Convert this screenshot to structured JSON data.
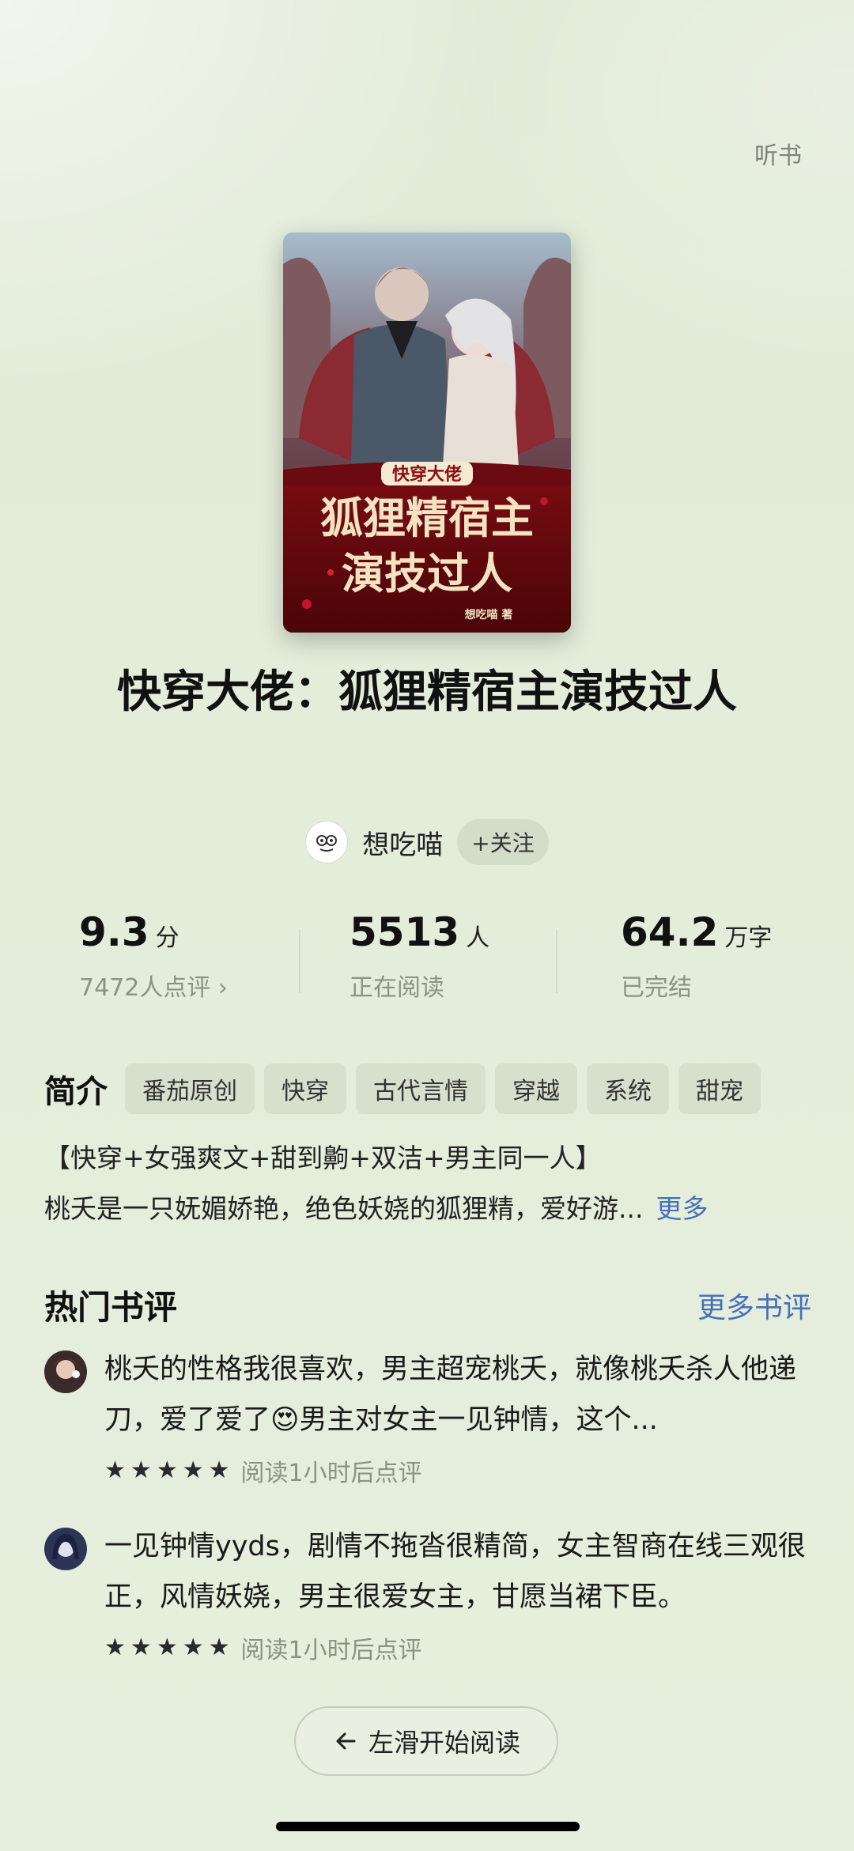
{
  "header": {
    "listen_label": "听书"
  },
  "book": {
    "cover_alt": "快穿大佬：狐狸精宿主演技过人",
    "title": "快穿大佬：狐狸精宿主演技过人",
    "author": "想吃喵",
    "follow_label": "+关注",
    "cover_text": {
      "top": "快穿大佬",
      "line1": "狐狸精宿主",
      "line2": "演技过人",
      "byline": "想吃喵 著"
    }
  },
  "stats": [
    {
      "value": "9.3",
      "unit": "分",
      "sub": "7472人点评 ›"
    },
    {
      "value": "5513",
      "unit": "人",
      "sub": "正在阅读"
    },
    {
      "value": "64.2",
      "unit": "万字",
      "sub": "已完结"
    }
  ],
  "intro": {
    "label": "简介",
    "tags": [
      "番茄原创",
      "快穿",
      "古代言情",
      "穿越",
      "系统",
      "甜宠"
    ],
    "line1": "【快穿+女强爽文+甜到齁+双洁+男主同一人】",
    "line2": "桃夭是一只妩媚娇艳，绝色妖娆的狐狸精，爱好游...",
    "more_label": "更多"
  },
  "reviews": {
    "title": "热门书评",
    "more_label": "更多书评",
    "items": [
      {
        "text": "桃夭的性格我很喜欢，男主超宠桃夭，就像桃夭杀人他递刀，爱了爱了😍男主对女主一见钟情，这个...",
        "stars": 5,
        "time": "阅读1小时后点评"
      },
      {
        "text": "一见钟情yyds，剧情不拖沓很精简，女主智商在线三观很正，风情妖娆，男主很爱女主，甘愿当裙下臣。",
        "stars": 5,
        "time": "阅读1小时后点评"
      }
    ]
  },
  "start_reading": {
    "icon": "arrow-left-icon",
    "label": "左滑开始阅读"
  },
  "colors": {
    "background": "#e4eddb",
    "link": "#4670b8",
    "cover_red": "#8a0f14"
  }
}
